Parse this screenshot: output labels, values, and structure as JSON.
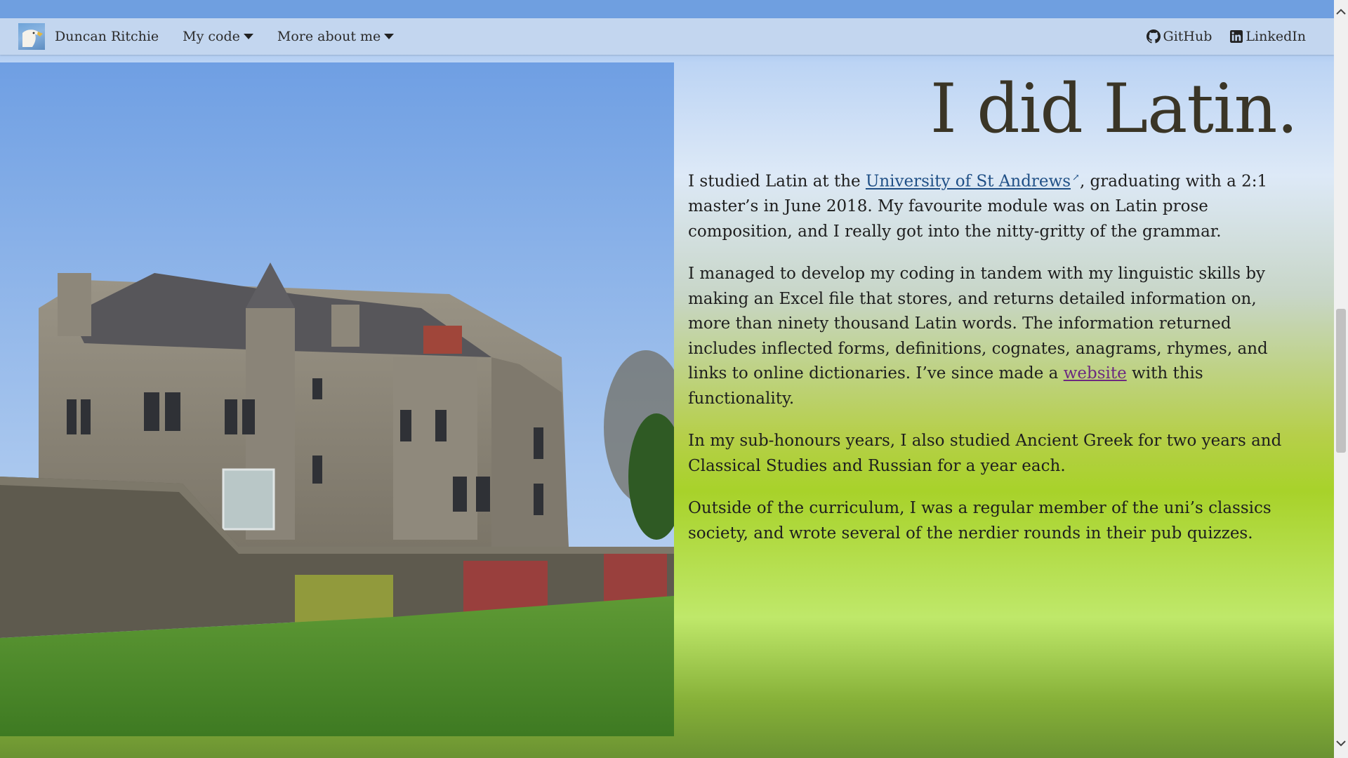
{
  "nav": {
    "site_name": "Duncan Ritchie",
    "menu_code": "My code",
    "menu_about": "More about me",
    "github": "GitHub",
    "linkedin": "LinkedIn"
  },
  "main": {
    "heading": "I did Latin.",
    "p1_before": "I studied Latin at the ",
    "p1_link": "University of St Andrews",
    "p1_after": ", graduating with a 2:1 master’s in June 2018. My favourite module was on Latin prose composition, and I really got into the nitty-gritty of the grammar.",
    "p2_before": "I managed to develop my coding in tandem with my linguistic skills by making an Excel file that stores, and returns detailed information on, more than ninety thousand Latin words. The information returned includes inflected forms, definitions, cognates, anagrams, rhymes, and links to online dictionaries. I’ve since made a ",
    "p2_link": "website",
    "p2_after": " with this functionality.",
    "p3": "In my sub-honours years, I also studied Ancient Greek for two years and Classical Studies and Russian for a year each.",
    "p4": "Outside of the curriculum, I was a regular member of the uni’s classics society, and wrote several of the nerdier rounds in their pub quizzes."
  },
  "icons": {
    "logo": "eagle-head-logo",
    "caret": "caret-down-icon",
    "github": "github-icon",
    "linkedin": "linkedin-icon",
    "external": "external-link-icon"
  },
  "colors": {
    "navbar": "#c3d6ef",
    "link": "#1f4f86",
    "visited_link": "#6c2a80",
    "heading": "#3a3526"
  }
}
